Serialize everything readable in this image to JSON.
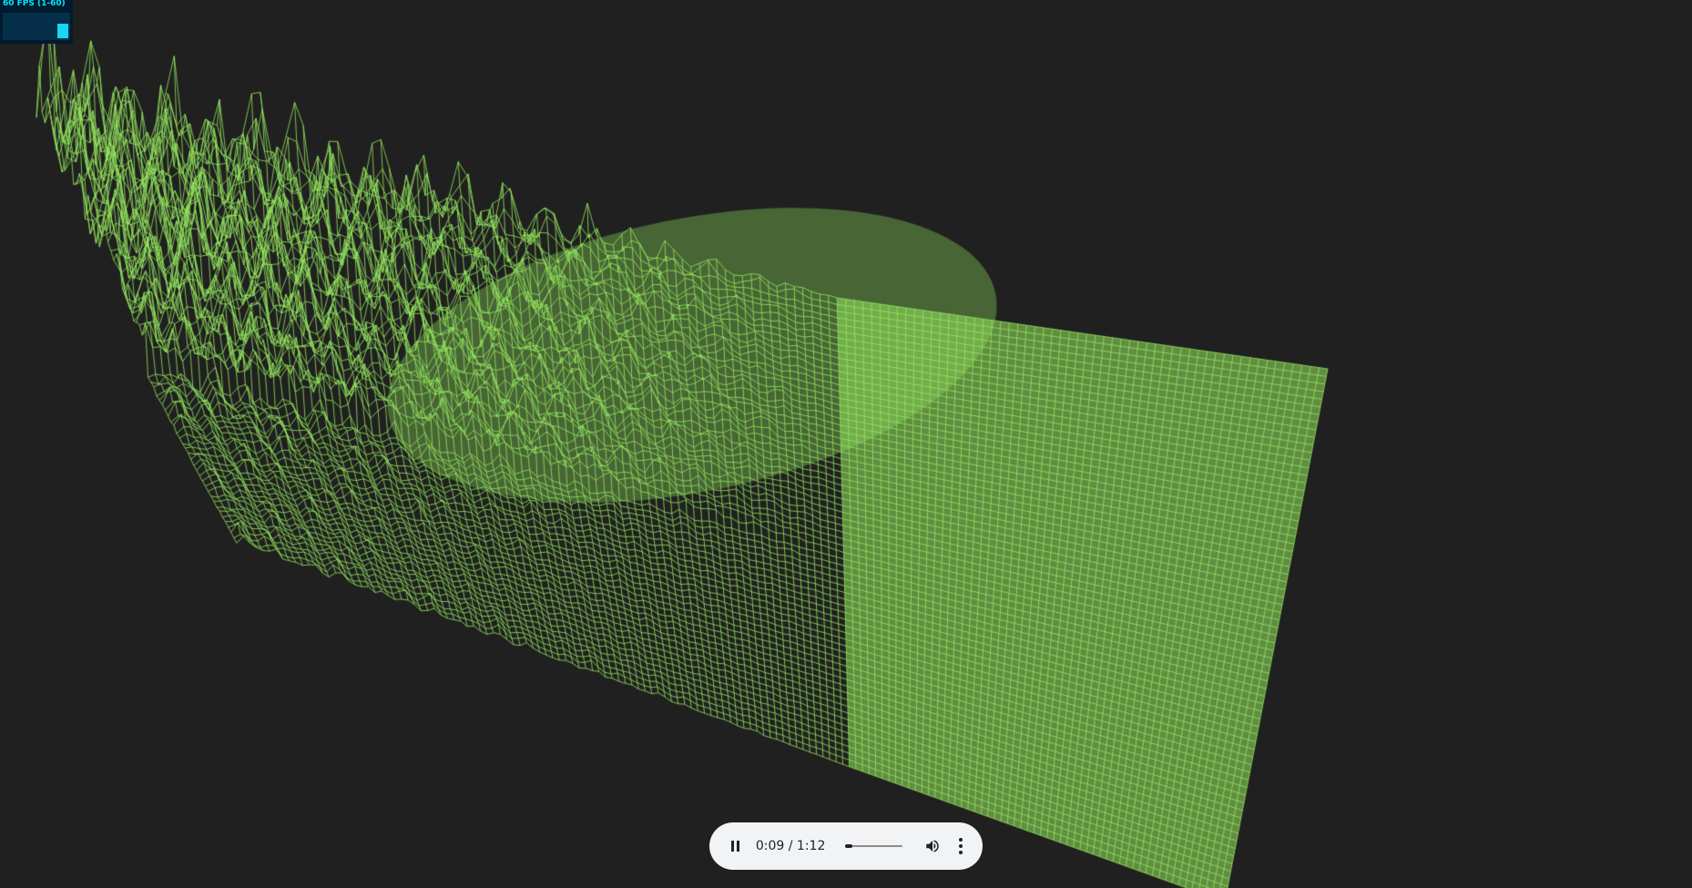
{
  "stats": {
    "fps_label": "60 FPS (1-60)",
    "fps": 60,
    "fps_min": 1,
    "fps_max": 60
  },
  "visualizer": {
    "wire_color": "#96e85e",
    "background": "#202020",
    "icon": "wireframe-terrain"
  },
  "player": {
    "current_time": "0:09",
    "separator": "/",
    "duration": "1:12",
    "progress": 0.125,
    "play_state_icon": "pause-icon",
    "volume_icon": "volume-icon",
    "menu_icon": "more-vert-icon"
  }
}
